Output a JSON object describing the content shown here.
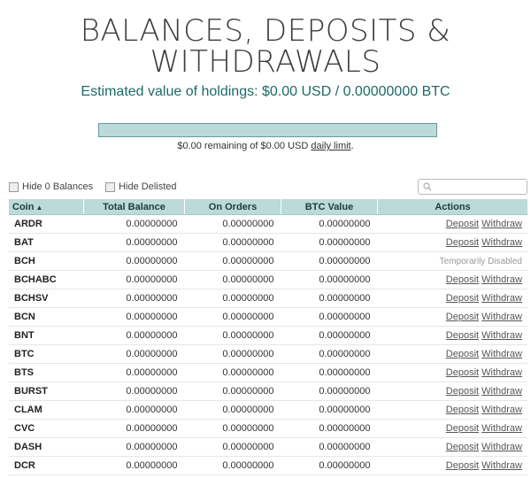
{
  "header": {
    "title": "BALANCES, DEPOSITS & WITHDRAWALS",
    "estimated_label": "Estimated value of holdings: $0.00 USD / 0.00000000 BTC"
  },
  "limit": {
    "fill_fraction": 1.0,
    "text_prefix": "$0.00 remaining of $0.00 USD",
    "link_label": "daily limit",
    "text_suffix": "."
  },
  "filters": {
    "hide_zero_label": "Hide 0 Balances",
    "hide_delisted_label": "Hide Delisted"
  },
  "search": {
    "placeholder": "",
    "icon": "search-icon"
  },
  "table": {
    "columns": [
      "Coin",
      "Total Balance",
      "On Orders",
      "BTC Value",
      "Actions"
    ],
    "sort_icon": "▲",
    "deposit_label": "Deposit",
    "withdraw_label": "Withdraw",
    "disabled_label": "Temporarily Disabled",
    "rows": [
      {
        "coin": "ARDR",
        "total": "0.00000000",
        "on_orders": "0.00000000",
        "btc": "0.00000000",
        "disabled": false
      },
      {
        "coin": "BAT",
        "total": "0.00000000",
        "on_orders": "0.00000000",
        "btc": "0.00000000",
        "disabled": false
      },
      {
        "coin": "BCH",
        "total": "0.00000000",
        "on_orders": "0.00000000",
        "btc": "0.00000000",
        "disabled": true
      },
      {
        "coin": "BCHABC",
        "total": "0.00000000",
        "on_orders": "0.00000000",
        "btc": "0.00000000",
        "disabled": false
      },
      {
        "coin": "BCHSV",
        "total": "0.00000000",
        "on_orders": "0.00000000",
        "btc": "0.00000000",
        "disabled": false
      },
      {
        "coin": "BCN",
        "total": "0.00000000",
        "on_orders": "0.00000000",
        "btc": "0.00000000",
        "disabled": false
      },
      {
        "coin": "BNT",
        "total": "0.00000000",
        "on_orders": "0.00000000",
        "btc": "0.00000000",
        "disabled": false
      },
      {
        "coin": "BTC",
        "total": "0.00000000",
        "on_orders": "0.00000000",
        "btc": "0.00000000",
        "disabled": false
      },
      {
        "coin": "BTS",
        "total": "0.00000000",
        "on_orders": "0.00000000",
        "btc": "0.00000000",
        "disabled": false
      },
      {
        "coin": "BURST",
        "total": "0.00000000",
        "on_orders": "0.00000000",
        "btc": "0.00000000",
        "disabled": false
      },
      {
        "coin": "CLAM",
        "total": "0.00000000",
        "on_orders": "0.00000000",
        "btc": "0.00000000",
        "disabled": false
      },
      {
        "coin": "CVC",
        "total": "0.00000000",
        "on_orders": "0.00000000",
        "btc": "0.00000000",
        "disabled": false
      },
      {
        "coin": "DASH",
        "total": "0.00000000",
        "on_orders": "0.00000000",
        "btc": "0.00000000",
        "disabled": false
      },
      {
        "coin": "DCR",
        "total": "0.00000000",
        "on_orders": "0.00000000",
        "btc": "0.00000000",
        "disabled": false
      }
    ]
  }
}
